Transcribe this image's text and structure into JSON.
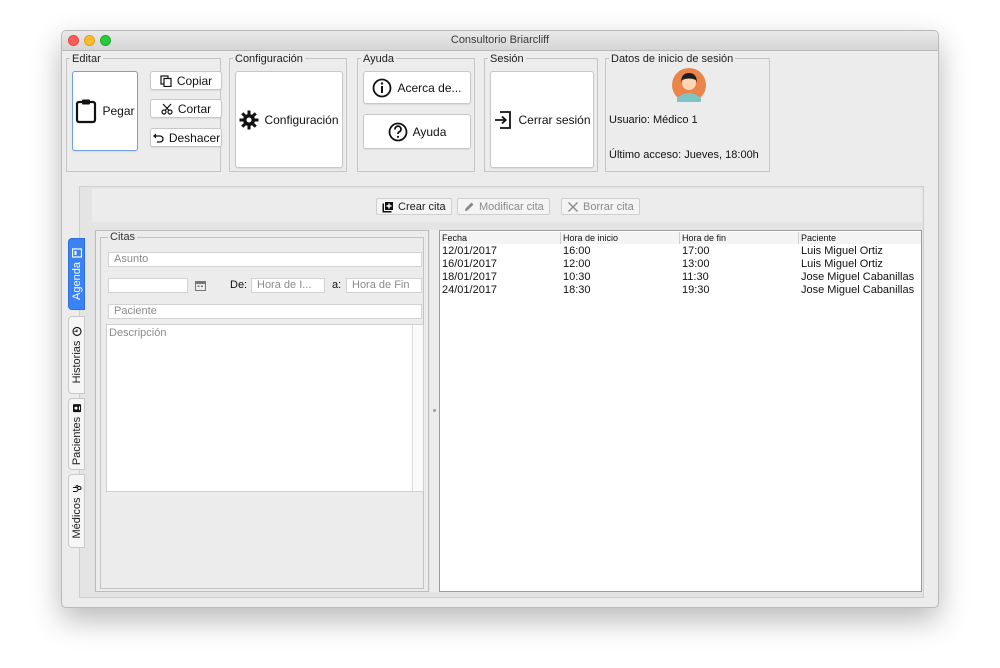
{
  "window": {
    "title": "Consultorio Briarcliff"
  },
  "ribbon": {
    "editar": {
      "title": "Editar",
      "paste": "Pegar",
      "copy": "Copiar",
      "cut": "Cortar",
      "undo": "Deshacer"
    },
    "configuracion": {
      "title": "Configuración",
      "button": "Configuración"
    },
    "ayuda": {
      "title": "Ayuda",
      "about": "Acerca de...",
      "help": "Ayuda"
    },
    "sesion": {
      "title": "Sesión",
      "logout": "Cerrar sesión"
    },
    "login": {
      "title": "Datos de inicio de sesión",
      "user": "Usuario: Médico 1",
      "last": "Último acceso: Jueves, 18:00h"
    }
  },
  "toolbar": {
    "create": "Crear cita",
    "modify": "Modificar cita",
    "delete": "Borrar cita"
  },
  "tabs": [
    {
      "label": "Agenda",
      "active": true
    },
    {
      "label": "Historias",
      "active": false
    },
    {
      "label": "Pacientes",
      "active": false
    },
    {
      "label": "Médicos",
      "active": false
    }
  ],
  "form": {
    "title": "Citas",
    "asunto_placeholder": "Asunto",
    "de_label": "De:",
    "hora_ini_placeholder": "Hora de I...",
    "a_label": "a:",
    "hora_fin_placeholder": "Hora de Fin",
    "paciente_placeholder": "Paciente",
    "descripcion_placeholder": "Descripción"
  },
  "table": {
    "headers": [
      "Fecha",
      "Hora de inicio",
      "Hora de fin",
      "Paciente"
    ],
    "rows": [
      [
        "12/01/2017",
        "16:00",
        "17:00",
        "Luis Miguel Ortiz"
      ],
      [
        "16/01/2017",
        "12:00",
        "13:00",
        "Luis Miguel Ortiz"
      ],
      [
        "18/01/2017",
        "10:30",
        "11:30",
        "Jose Miguel Cabanillas"
      ],
      [
        "24/01/2017",
        "18:30",
        "19:30",
        "Jose Miguel Cabanillas"
      ]
    ]
  },
  "colors": {
    "accent": "#3b82f6",
    "avatar_bg": "#e9844a"
  },
  "icons": [
    "clipboard-icon",
    "copy-icon",
    "scissors-icon",
    "undo-icon",
    "gear-icon",
    "info-icon",
    "question-icon",
    "logout-icon",
    "avatar-icon",
    "add-icon",
    "pencil-icon",
    "close-icon",
    "calendar-icon",
    "book-icon",
    "clock-icon",
    "contact-icon",
    "stethoscope-icon"
  ]
}
